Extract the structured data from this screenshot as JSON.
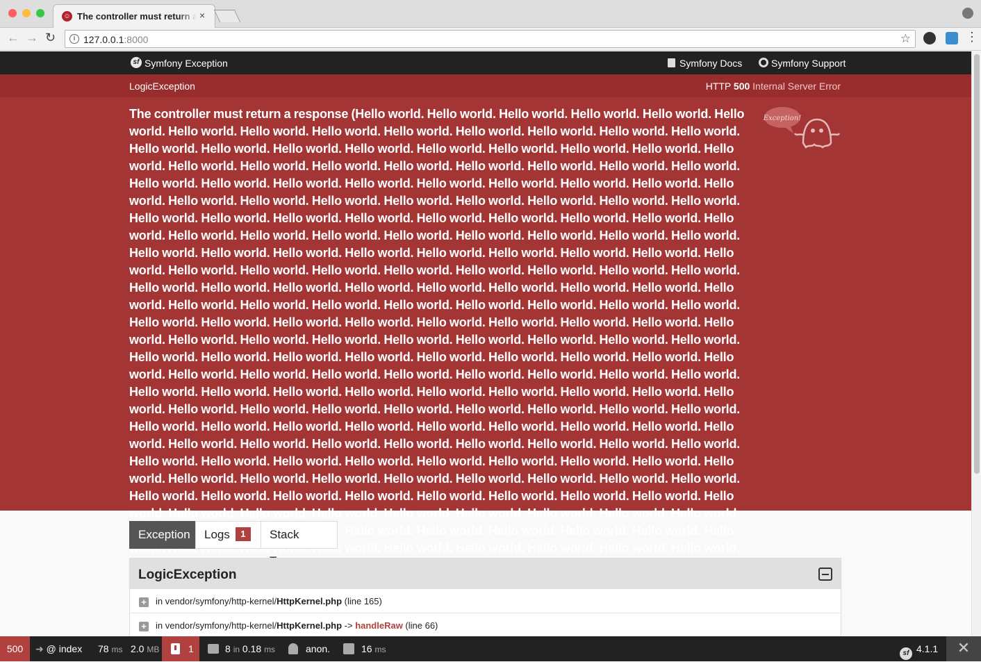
{
  "browser": {
    "tab_title": "The controller must return a",
    "tab_close": "×",
    "url_host": "127.0.0.1",
    "url_port": ":8000",
    "colors": {
      "close": "#fc605c",
      "minimize": "#fdbc40",
      "zoom": "#34c84a"
    }
  },
  "header": {
    "brand": "Symfony Exception",
    "docs_link": "Symfony Docs",
    "support_link": "Symfony Support"
  },
  "summary": {
    "exception_class": "LogicException",
    "http_prefix": "HTTP",
    "http_code": "500",
    "http_text": "Internal Server Error"
  },
  "exception": {
    "message": "The controller must return a response (Hello world. Hello world. Hello world. Hello world. Hello world. Hello world. Hello world. Hello world. Hello world. Hello world. Hello world. Hello world. Hello world. Hello world. Hello world. Hello world. Hello world. Hello world. Hello world. Hello world. Hello world. Hello world. Hello world. Hello world. Hello world. Hello world. Hello world. Hello world. Hello world. Hello world. Hello world. Hello world. Hello world. Hello world. Hello world. Hello world. Hello world. Hello world. Hello world. Hello world. Hello world. Hello world. Hello world. Hello world. Hello world. Hello world. Hello world. Hello world. Hello world. Hello world. Hello world. Hello world. Hello world. Hello world. Hello world. Hello world. Hello world. Hello world. Hello world. Hello world. Hello world. Hello world. Hello world. Hello world. Hello world. Hello world. Hello world. Hello world. Hello world. Hello world. Hello world. Hello world. Hello world. Hello world. Hello world. Hello world. Hello world. Hello world. Hello world. Hello world. Hello world. Hello world. Hello world. Hello world. Hello world. Hello world. Hello world. Hello world. Hello world. Hello world. Hello world. Hello world. Hello world. Hello world. Hello world. Hello world. Hello world. Hello world. Hello world. Hello world. Hello world. Hello world. Hello world. Hello world. Hello world. Hello world. Hello world. Hello world. Hello world. Hello world. Hello world. Hello world. Hello world. Hello world. Hello world. Hello world. Hello world. Hello world. Hello world. Hello world. Hello world. Hello world. Hello world. Hello world. Hello world. Hello world. Hello world. Hello world. Hello world. Hello world. Hello world. Hello world. Hello world. Hello world. Hello world. Hello world. Hello world. Hello world. Hello world. Hello world. Hello world. Hello world. Hello world. Hello world. Hello world. Hello world. Hello world. Hello world. Hello world. Hello world. Hello world. Hello world. Hello world. Hello world. Hello world. Hello world. Hello world. Hello world. Hello world. Hello world. Hello world. Hello world. Hello world. Hello world. Hello world. Hello world. Hello world. Hello world. Hello world. Hello world. Hello world. Hello world. Hello world. Hello world. Hello world. Hello world. Hello world. Hello world. Hello world. Hello world. Hello world. Hello world. Hello world. Hello world. Hello world. Hello world. Hello world. Hello world. Hello world. Hello world. Hello world. Hello world. Hello world. Hello world. Hello world. Hello world. Hello world. Hello world. Hello world. Hello world. Hello world. Hello world. Hello world. Hello world. Hello world. Hello world. Hello world. Hello world. Hello world. Hello world. Hello world. Hello world. Hello world. Hello world. Hello world. Hello world. Hello world. Hello world. Hello world. Hello world. Hello world. Hello world. given).",
    "ghost_label": "Exception!"
  },
  "tabs": [
    {
      "label": "Exception",
      "active": true
    },
    {
      "label": "Logs",
      "badge": "1"
    },
    {
      "label": "Stack Trace"
    }
  ],
  "trace": {
    "title": "LogicException",
    "lines": [
      {
        "prefix": "in vendor/symfony/http-kernel/",
        "file": "HttpKernel.php",
        "arrow": "",
        "func": "",
        "suffix": " (line 165)"
      },
      {
        "prefix": "in vendor/symfony/http-kernel/",
        "file": "HttpKernel.php",
        "arrow": " -> ",
        "func": "handleRaw",
        "suffix": " (line 66)"
      }
    ]
  },
  "debug_toolbar": {
    "status_code": "500",
    "route": "@ index",
    "time_value": "78",
    "time_unit": "ms",
    "memory_value": "2.0",
    "memory_unit": "MB",
    "exceptions": "1",
    "twig_count": "8",
    "twig_in": "in",
    "twig_time": "0.18",
    "twig_unit": "ms",
    "user": "anon.",
    "db_value": "16",
    "db_unit": "ms",
    "version": "4.1.1",
    "close": "✕"
  }
}
